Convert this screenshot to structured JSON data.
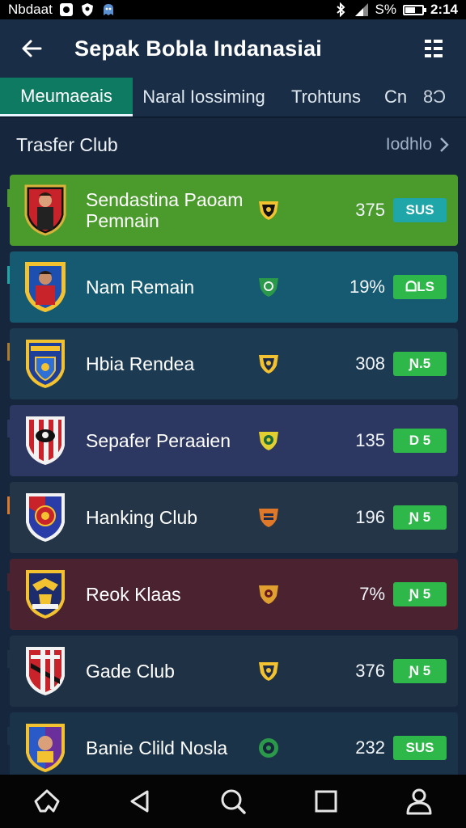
{
  "status_bar": {
    "carrier": "Nbdaat",
    "battery_text": "S%",
    "battery_level": 0.6,
    "time": "2:14"
  },
  "app_bar": {
    "title": "Sepak Bobla  Indanasiai",
    "back_icon": "arrow-left-icon",
    "menu_icon": "more-menu-icon"
  },
  "tabs": [
    {
      "label": "Meumaeais",
      "active": true
    },
    {
      "label": "Naral Iossiming",
      "active": false
    },
    {
      "label": "Trohtuns",
      "active": false
    },
    {
      "label": "Cn",
      "active": false
    },
    {
      "label": "8Ɔ",
      "active": false
    }
  ],
  "section": {
    "title": "Trasfer Club",
    "see_all_label": "Iodhlo"
  },
  "clubs": [
    {
      "name": "Sendastina Paoam Pemnain",
      "value": "375",
      "button": "SUS",
      "row_color": "#4b9b2c",
      "button_color": "#1fa6a8",
      "accent": "#4b9b2c",
      "crest": "player-red-black-crest-icon",
      "badge": "yellow-black-shield-icon"
    },
    {
      "name": "Nam Remain",
      "value": "19%",
      "button": "ᗝLS",
      "row_color": "#165a72",
      "button_color": "#2fb84a",
      "accent": "#1fa6a8",
      "crest": "player-blue-red-crest-icon",
      "badge": "green-shield-icon"
    },
    {
      "name": "Hbia Rendea",
      "value": "308",
      "button": "Ɲ.5",
      "row_color": "#1c3a52",
      "button_color": "#2fb84a",
      "accent": "#b07a2c",
      "crest": "blue-yellow-crest-icon",
      "badge": "yellow-shield-icon"
    },
    {
      "name": "Sepafer Peraaien",
      "value": "135",
      "button": "D 5",
      "row_color": "#2c3762",
      "button_color": "#2fb84a",
      "accent": "#2c3762",
      "crest": "red-white-stripes-crest-icon",
      "badge": "yellow-green-shield-icon"
    },
    {
      "name": "Hanking Club",
      "value": "196",
      "button": "Ɲ 5",
      "row_color": "#243548",
      "button_color": "#2fb84a",
      "accent": "#e0782a",
      "crest": "red-blue-crest-icon",
      "badge": "orange-shield-icon"
    },
    {
      "name": "Reok Klaas",
      "value": "7%",
      "button": "Ɲ 5",
      "row_color": "#4a2230",
      "button_color": "#2fb84a",
      "accent": "#4a2230",
      "crest": "yellow-blue-eagle-crest-icon",
      "badge": "gold-shield-icon"
    },
    {
      "name": "Gade Club",
      "value": "376",
      "button": "Ɲ 5",
      "row_color": "#1f3144",
      "button_color": "#2fb84a",
      "accent": "#1f3144",
      "crest": "red-white-black-crest-icon",
      "badge": "yellow-shield-icon"
    },
    {
      "name": "Banie Clild Nosla",
      "value": "232",
      "button": "SUS",
      "row_color": "#1b3348",
      "button_color": "#2fb84a",
      "accent": "#1b3348",
      "crest": "purple-blue-crest-icon",
      "badge": "green-ring-shield-icon"
    }
  ],
  "bottom_nav": [
    {
      "icon": "home-icon"
    },
    {
      "icon": "back-triangle-icon"
    },
    {
      "icon": "search-icon"
    },
    {
      "icon": "recents-square-icon"
    },
    {
      "icon": "profile-icon"
    }
  ]
}
